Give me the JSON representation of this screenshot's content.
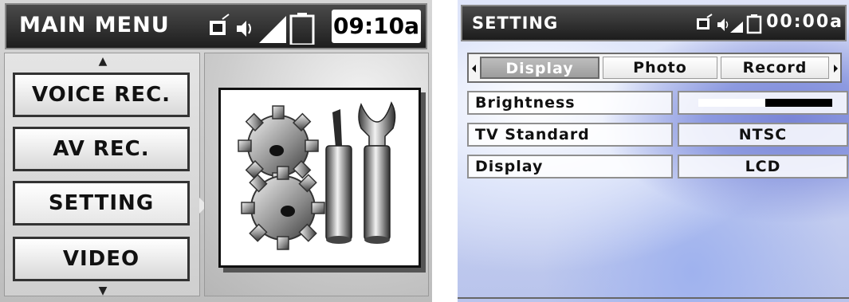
{
  "left_screen": {
    "header": {
      "title": "MAIN MENU",
      "time": "09:10a"
    },
    "menu": {
      "items": [
        {
          "label": "VOICE REC."
        },
        {
          "label": "AV REC."
        },
        {
          "label": "SETTING"
        },
        {
          "label": "VIDEO"
        }
      ],
      "selected": "SETTING"
    },
    "preview_icon": "settings-tools-icon"
  },
  "right_screen": {
    "header": {
      "title": "SETTING",
      "time": "00:00a"
    },
    "tabs": [
      {
        "label": "Display",
        "active": true
      },
      {
        "label": "Photo",
        "active": false
      },
      {
        "label": "Record",
        "active": false
      }
    ],
    "settings": {
      "brightness": {
        "label": "Brightness",
        "level": 0.5
      },
      "tv_standard": {
        "label": "TV Standard",
        "value": "NTSC"
      },
      "display": {
        "label": "Display",
        "value": "LCD"
      }
    }
  },
  "colors": {
    "header_bg": "#1e1e1e",
    "text_dark": "#111111",
    "accent_blue": "#8d9ae0"
  }
}
